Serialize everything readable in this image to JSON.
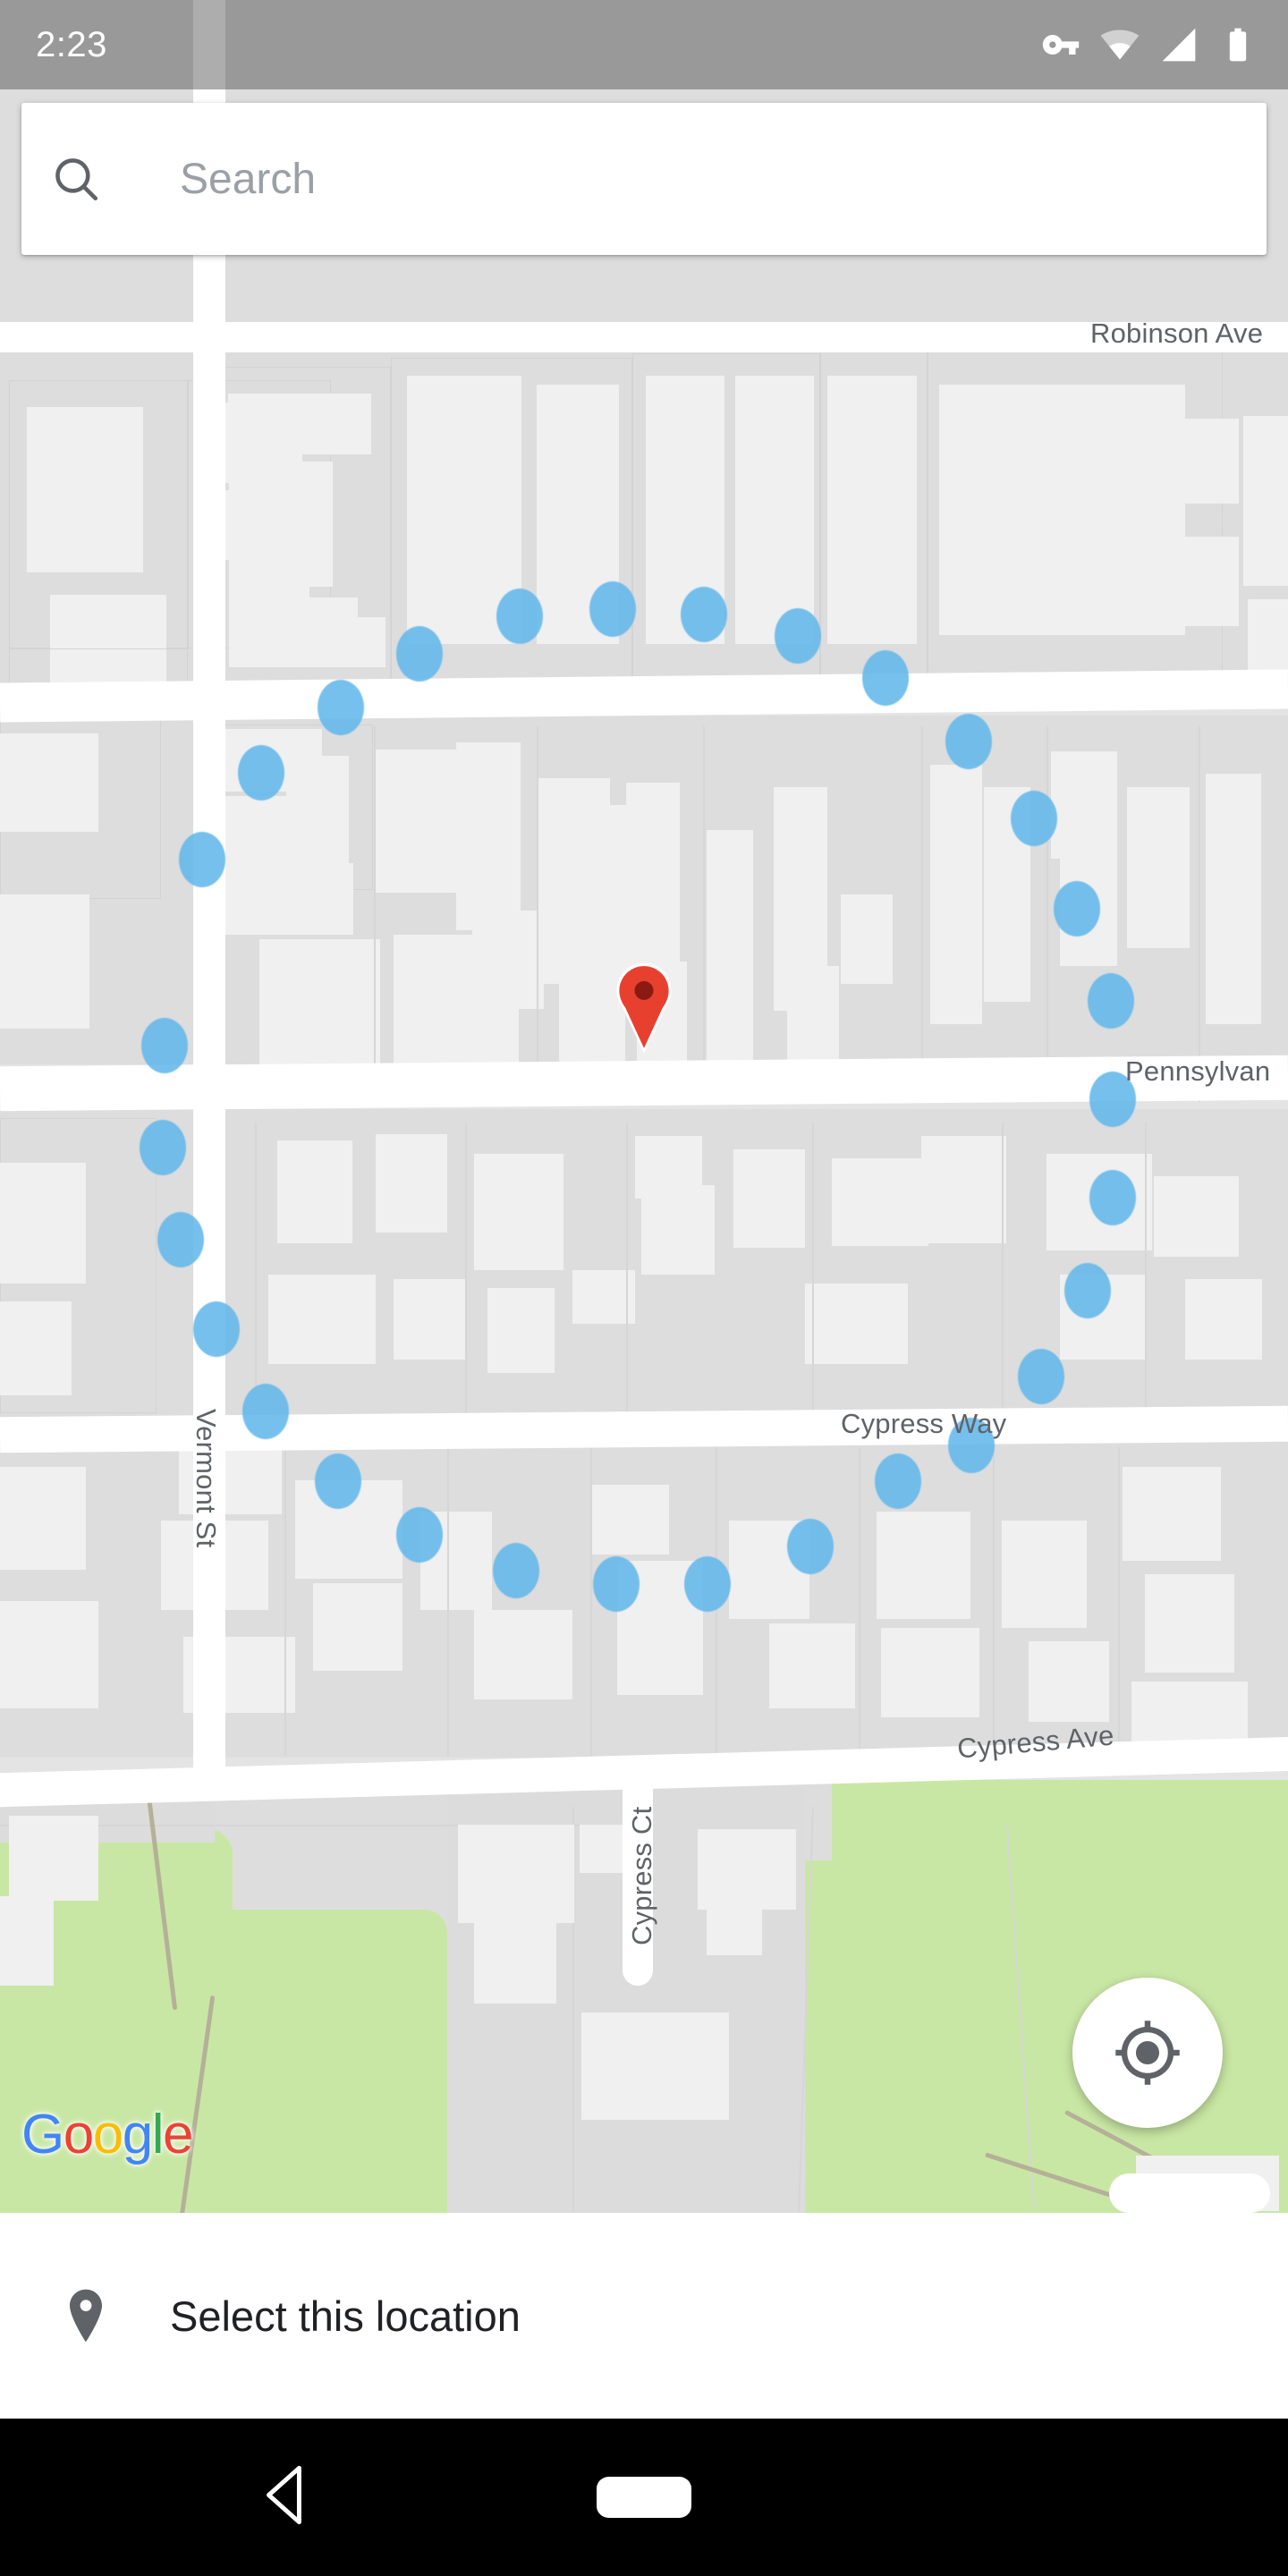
{
  "status_bar": {
    "time": "2:23",
    "icons": [
      {
        "name": "vpn-key-icon",
        "label": "VPN"
      },
      {
        "name": "wifi-icon",
        "label": "Wi-Fi"
      },
      {
        "name": "cellular-signal-icon",
        "label": "Signal"
      },
      {
        "name": "battery-icon",
        "label": "Battery"
      }
    ]
  },
  "search": {
    "placeholder": "Search",
    "value": "",
    "icon": "search-icon"
  },
  "map": {
    "provider_logo": "Google",
    "provider_logo_letters": [
      "G",
      "o",
      "o",
      "g",
      "l",
      "e"
    ],
    "marker": {
      "type": "location-pin",
      "color": "#ea4335",
      "center_color": "#8b1a12"
    },
    "my_location_button": {
      "icon": "my-location-crosshair-icon",
      "label": "My location"
    },
    "street_view_dot_color": "#63b8eb",
    "park_color": "#c9e7a4",
    "road_color": "#ffffff",
    "block_color": "#dddddd",
    "building_color": "#f0f0f0",
    "labels": [
      {
        "text": "Robinson Ave",
        "orientation": "horizontal"
      },
      {
        "text": "Pennsylvan",
        "orientation": "horizontal"
      },
      {
        "text": "Cypress Way",
        "orientation": "horizontal"
      },
      {
        "text": "Cypress Ave",
        "orientation": "horizontal"
      },
      {
        "text": "Vermont St",
        "orientation": "vertical-down"
      },
      {
        "text": "Cypress Ct",
        "orientation": "vertical-up"
      }
    ]
  },
  "bottom_sheet": {
    "select_location_label": "Select this location",
    "pin_icon": "location-pin-icon"
  },
  "nav_bar": {
    "back": "back-button",
    "home": "home-button"
  }
}
